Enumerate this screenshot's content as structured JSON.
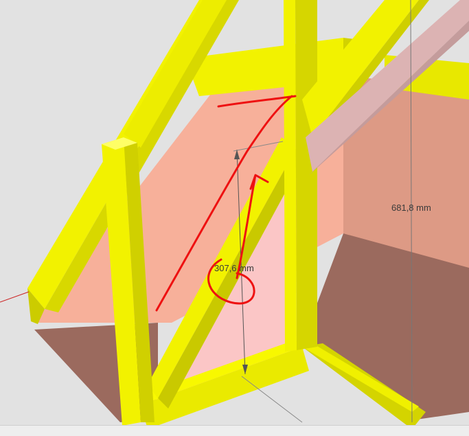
{
  "app": {
    "type": "3d-modeling-viewport"
  },
  "model": {
    "colors": {
      "background": "#e2e2e2",
      "frame_yellow_light": "#f2f200",
      "frame_yellow_mid": "#e2e200",
      "frame_yellow_dark": "#c9c900",
      "wall_salmon": "#f7b09a",
      "wall_salmon_right": "#dd9a85",
      "panel_pink": "#fbc6c6",
      "floor_brown": "#9b6a5e",
      "beam_pink": "#dcb3b3",
      "sketch_red": "#ee1111",
      "dimension_line": "#555555"
    }
  },
  "dimensions": [
    {
      "id": "dim-height-left",
      "label": "307,6 mm"
    },
    {
      "id": "dim-height-right",
      "label": "681,8 mm"
    }
  ],
  "annotations": {
    "type": "freehand-red-marker",
    "description_visible": ""
  }
}
